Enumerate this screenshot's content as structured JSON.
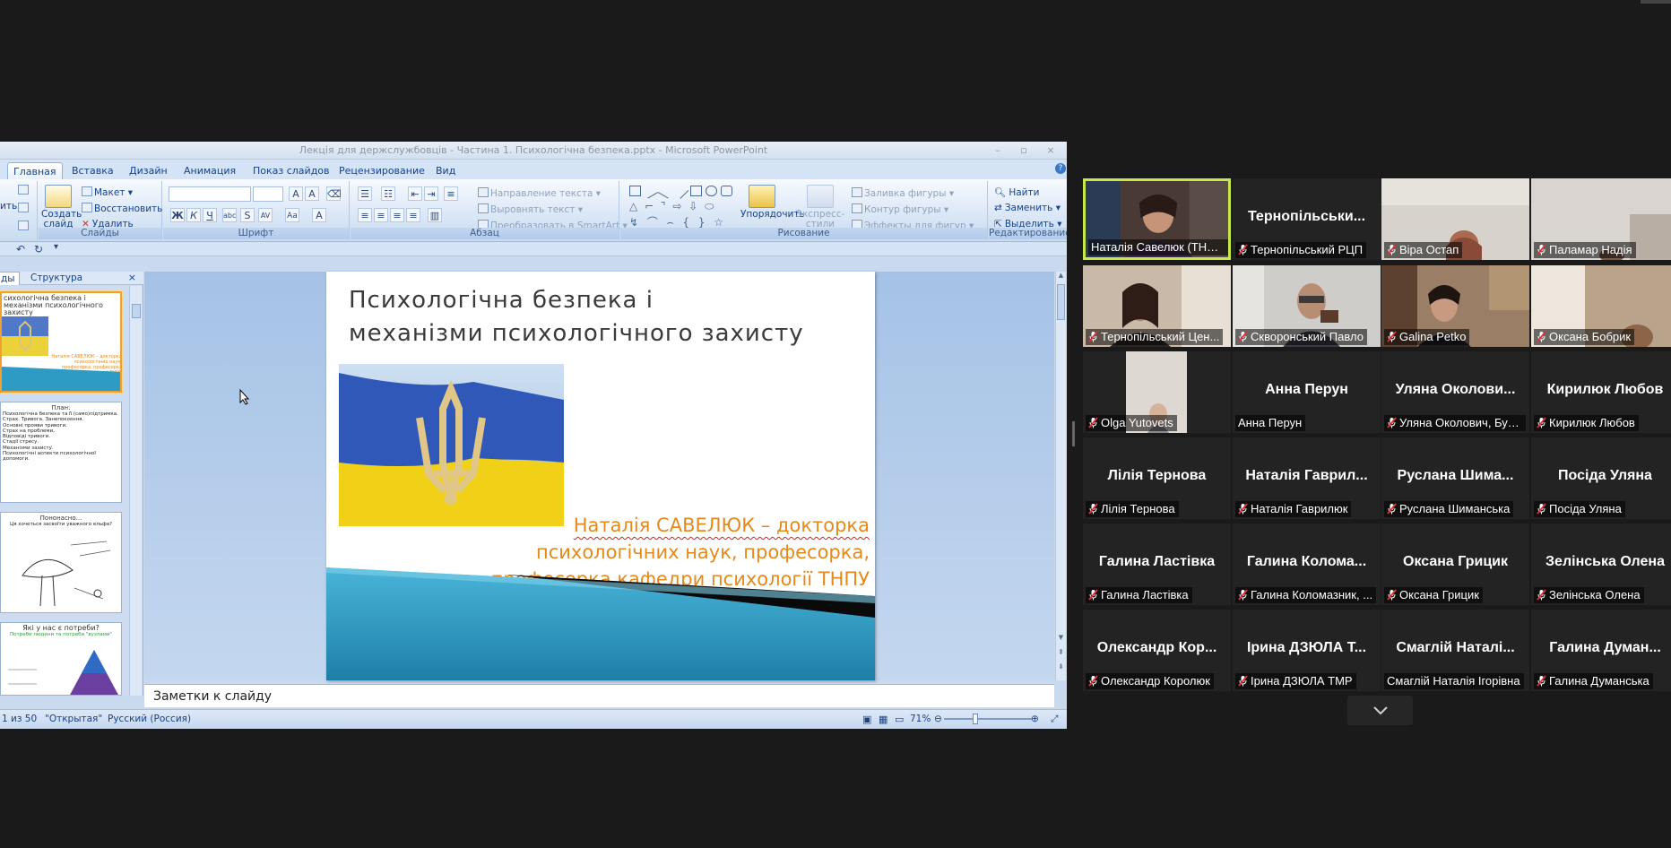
{
  "ppt": {
    "window_title": "Лекція для держслужбовців - Частина 1. Психологічна безпека.pptx - Microsoft PowerPoint",
    "tabs": [
      "Главная",
      "Вставка",
      "Дизайн",
      "Анимация",
      "Показ слайдов",
      "Рецензирование",
      "Вид"
    ],
    "ribbon": {
      "slides_group": {
        "label": "Слайды",
        "create_slide": "Создать слайд",
        "layout": "Макет",
        "reset": "Восстановить",
        "delete": "Удалить"
      },
      "font_group": {
        "label": "Шрифт"
      },
      "paragraph_group": {
        "label": "Абзац",
        "text_direction": "Направление текста",
        "align_text": "Выровнять текст",
        "smartart": "Преобразовать в SmartArt"
      },
      "drawing_group": {
        "label": "Рисование",
        "arrange": "Упорядочить",
        "quick_styles": "Экспресс-стили",
        "shape_fill": "Заливка фигуры",
        "shape_outline": "Контур фигуры",
        "shape_effects": "Эффекты для фигур"
      },
      "editing_group": {
        "label": "Редактирование",
        "find": "Найти",
        "replace": "Заменить",
        "select": "Выделить"
      }
    },
    "panel_tabs": [
      "ды",
      "Структура"
    ],
    "thumbs": [
      {
        "title": "сихологічна безпека  і механізми психологічного захисту",
        "author": "Наталія САВЕЛЮК – докторка психологічних наук, професорка, професорка кафедри психології ТНПУ"
      },
      {
        "title": "План:",
        "lines": [
          "Психологічна безпека та її (само)підтримка.",
          "Страх. Тривога. Занепокоєння.",
          "Основні прояви тривоги.",
          "Страх на проблеми,",
          "Відповіді тривоги.",
          "Стадії стресу.",
          "Механізми захисту.",
          "Психологічні аспекти психологічної",
          "допомоги."
        ]
      },
      {
        "title": "Пононасно...",
        "subtitle": "Ця хочеться засвоїти уважного ельфа?"
      },
      {
        "title": "Які у нас є потреби?",
        "subtitle": "Потреби людини та потреби \"вузлами\""
      }
    ],
    "slide": {
      "title_line1": "Психологічна безпека  і",
      "title_line2": "механізми психологічного захисту",
      "author_line1": "Наталія САВЕЛЮК – докторка",
      "author_line2": "психологічних наук, професорка,",
      "author_line3": "професорка кафедри психології ТНПУ"
    },
    "notes_placeholder": "Заметки к слайду",
    "status": {
      "slide_counter": "1 из 50",
      "theme": "\"Открытая\"",
      "language": "Русский (Россия)",
      "zoom": "71%"
    }
  },
  "gallery": [
    {
      "id": "nataliia",
      "label": "Наталія Савелюк (ТНПУ)",
      "center": "",
      "muted": false,
      "video": true,
      "speaking": true
    },
    {
      "id": "ternopil-rtsp",
      "label": "Тернопільський РЦП",
      "center": "Тернопільськи...",
      "muted": true,
      "video": false
    },
    {
      "id": "vira",
      "label": "Віра Остап",
      "center": "",
      "muted": true,
      "video": true
    },
    {
      "id": "palamar",
      "label": "Паламар Надія",
      "center": "",
      "muted": true,
      "video": true
    },
    {
      "id": "ternopil-center",
      "label": "Тернопільський Цен...",
      "center": "",
      "muted": true,
      "video": true
    },
    {
      "id": "skovronskyi",
      "label": "Скворонський Павло",
      "center": "",
      "muted": true,
      "video": true
    },
    {
      "id": "galina-petko",
      "label": "Galina Petko",
      "center": "",
      "muted": true,
      "video": true
    },
    {
      "id": "bobryk",
      "label": "Оксана Бобрик",
      "center": "",
      "muted": true,
      "video": true
    },
    {
      "id": "olga",
      "label": "Olga Yutovets",
      "center": "",
      "muted": true,
      "video": true
    },
    {
      "id": "perun",
      "label": "Анна Перун",
      "center": "Анна Перун",
      "muted": false,
      "video": false
    },
    {
      "id": "okolovych",
      "label": "Уляна Околович, Буч...",
      "center": "Уляна  Околови...",
      "muted": true,
      "video": false
    },
    {
      "id": "kyryliuk",
      "label": "Кирилюк Любов",
      "center": "Кирилюк Любов",
      "muted": true,
      "video": false
    },
    {
      "id": "ternova",
      "label": "Лілія Тернова",
      "center": "Лілія Тернова",
      "muted": true,
      "video": false
    },
    {
      "id": "havryliuk",
      "label": "Наталія Гаврилюк",
      "center": "Наталія  Гаврил...",
      "muted": true,
      "video": false
    },
    {
      "id": "shymanska",
      "label": "Руслана Шиманська",
      "center": "Руслана  Шима...",
      "muted": true,
      "video": false
    },
    {
      "id": "posida",
      "label": "Посіда Уляна",
      "center": "Посіда Уляна",
      "muted": true,
      "video": false
    },
    {
      "id": "lastivka",
      "label": "Галина Ластівка",
      "center": "Галина Ластівка",
      "muted": true,
      "video": false
    },
    {
      "id": "kolomaznyk",
      "label": "Галина Коломазник, ...",
      "center": "Галина  Колома...",
      "muted": true,
      "video": false
    },
    {
      "id": "hrytsyk",
      "label": "Оксана Грицик",
      "center": "Оксана Грицик",
      "muted": true,
      "video": false
    },
    {
      "id": "zelinska",
      "label": "Зелінська Олена",
      "center": "Зелінська Олена",
      "muted": true,
      "video": false
    },
    {
      "id": "koroliuk",
      "label": "Олександр Королюк",
      "center": "Олександр  Кор...",
      "muted": true,
      "video": false
    },
    {
      "id": "dziula",
      "label": "Ірина ДЗЮЛА ТМР",
      "center": "Ірина ДЗЮЛА Т...",
      "muted": true,
      "video": false
    },
    {
      "id": "smahlii",
      "label": "Смаглій Наталія Ігорівна",
      "center": "Смаглій  Наталі...",
      "muted": false,
      "video": false
    },
    {
      "id": "dumanska",
      "label": "Галина Думанська",
      "center": "Галина  Думан...",
      "muted": true,
      "video": false
    }
  ],
  "colors": {
    "speaker_border": "#c6e84a",
    "muted_icon": "#e0303a",
    "slide_accent": "#e4891b"
  }
}
